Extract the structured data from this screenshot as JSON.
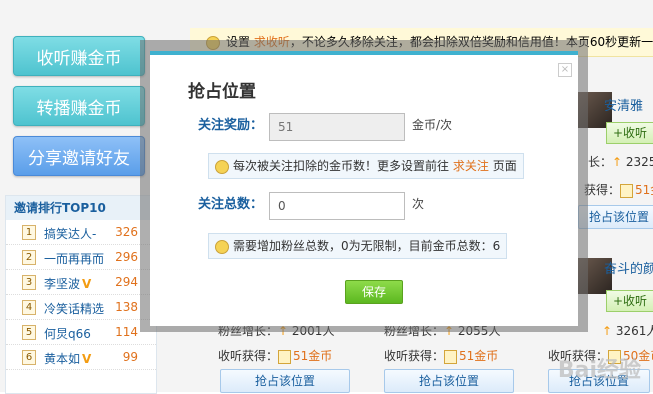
{
  "sidebar": {
    "buttons": [
      "收听赚金币",
      "转播赚金币",
      "分享邀请好友"
    ],
    "ranking": {
      "title": "邀请排行TOP10",
      "rows": [
        {
          "rank": "1",
          "name": "搞笑达人-",
          "value": "326",
          "vip": false
        },
        {
          "rank": "2",
          "name": "一而再再而",
          "value": "296",
          "vip": false
        },
        {
          "rank": "3",
          "name": "李坚波",
          "value": "294",
          "vip": true
        },
        {
          "rank": "4",
          "name": "冷笑话精选",
          "value": "138",
          "vip": false
        },
        {
          "rank": "5",
          "name": "何炅q66",
          "value": "114",
          "vip": false
        },
        {
          "rank": "6",
          "name": "黄本如",
          "value": "99",
          "vip": true
        }
      ]
    }
  },
  "notice": {
    "prefix": "设置",
    "link": "求收听",
    "text": "，不论多久移除关注，都会扣除双倍奖励和信用值！本页60秒更新一"
  },
  "cards": {
    "user1_name": "安清雅",
    "user2_name": "奋斗的颜",
    "follow_label": "+收听",
    "growth_label": "长：",
    "growth_1": "2325人",
    "growth_2": "3261人",
    "earn_label": "获得：",
    "earn_1": "51金币",
    "earn_2": "50金",
    "bottom_growth_label": "粉丝增长：",
    "bottom_growth_a": "2001人",
    "bottom_growth_b": "2055人",
    "earn_full_label": "收听获得：",
    "earn_a": "51金币",
    "earn_b": "51金币",
    "earn_c": "50金币",
    "locate_label": "抢占该位置"
  },
  "modal": {
    "title": "抢占位置",
    "reward_label": "关注奖励：",
    "reward_value": "51",
    "reward_unit": "金币/次",
    "hint1_text": "每次被关注扣除的金币数！更多设置前往",
    "hint1_link": "求关注",
    "hint1_suffix": "页面",
    "total_label": "关注总数：",
    "total_value": "0",
    "total_unit": "次",
    "hint2_text": "需要增加粉丝总数，0为无限制，目前金币总数：6",
    "save_label": "保存",
    "close_symbol": "×"
  },
  "watermark": "Bai经验"
}
